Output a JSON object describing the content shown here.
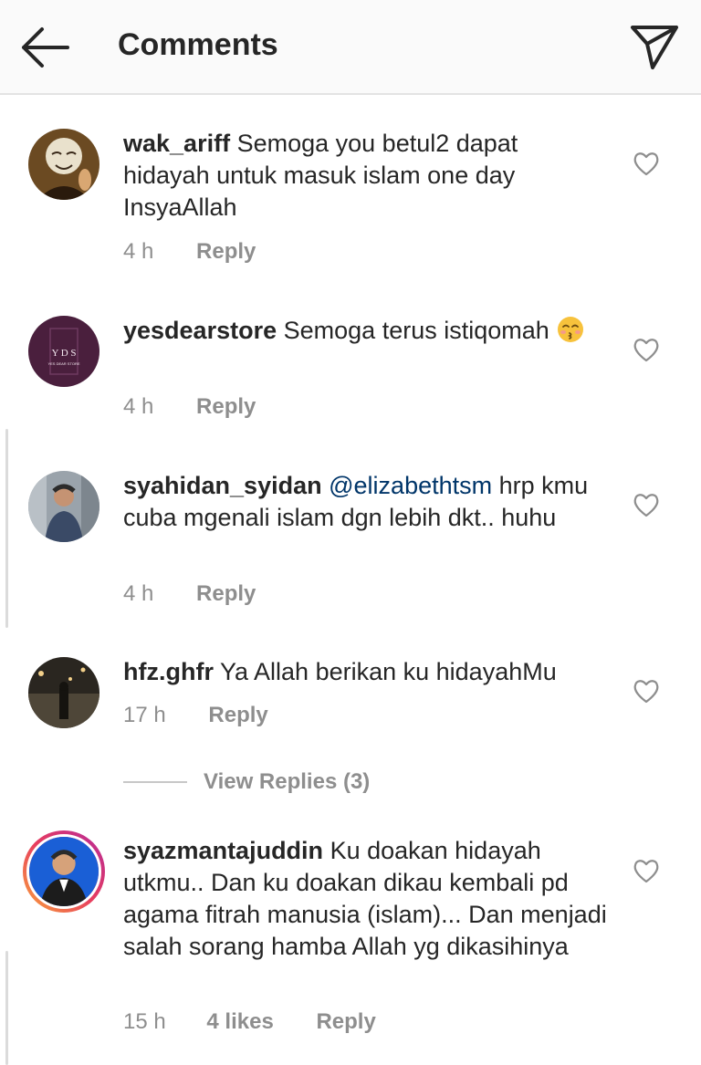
{
  "header": {
    "title": "Comments"
  },
  "comments": [
    {
      "username": "wak_ariff",
      "text": "Semoga you betul2 dapat hidayah untuk masuk islam one day InsyaAllah",
      "time": "4 h",
      "reply_label": "Reply"
    },
    {
      "username": "yesdearstore",
      "text": "Semoga terus istiqomah",
      "time": "4 h",
      "reply_label": "Reply",
      "avatar_text": "Y D S",
      "avatar_subtext": "YES DEAR STORE"
    },
    {
      "username": "syahidan_syidan",
      "mention": "@elizabethtsm",
      "text": "hrp kmu cuba mgenali islam dgn lebih dkt.. huhu",
      "time": "4 h",
      "reply_label": "Reply"
    },
    {
      "username": "hfz.ghfr",
      "text": "Ya Allah berikan ku hidayahMu",
      "time": "17 h",
      "reply_label": "Reply",
      "view_replies": "View Replies (3)"
    },
    {
      "username": "syazmantajuddin",
      "text": "Ku doakan hidayah utkmu.. Dan ku doakan dikau kembali pd agama fitrah manusia (islam)... Dan menjadi salah sorang hamba Allah yg dikasihinya",
      "time": "15 h",
      "likes": "4 likes",
      "reply_label": "Reply"
    }
  ],
  "colors": {
    "text": "#262626",
    "meta": "#8e8e8e",
    "mention": "#003569",
    "header_bg": "#fafafa"
  },
  "icons": {
    "back": "arrow-left-icon",
    "send": "paper-plane-icon",
    "like": "heart-outline-icon"
  }
}
